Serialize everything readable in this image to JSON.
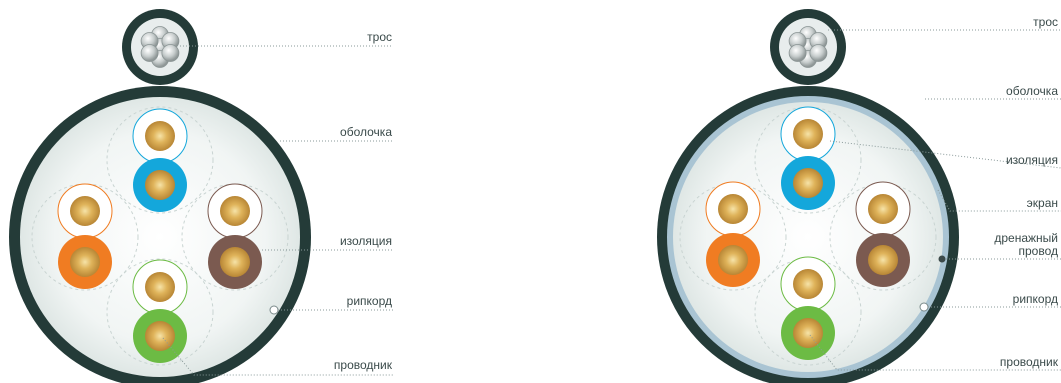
{
  "colors": {
    "jacket": "#243b38",
    "screen": "#a9c4d3",
    "blue": "#14a7db",
    "orange": "#f07c22",
    "brown": "#7b5a50",
    "green": "#6cbb44",
    "copper": "#d9a84b",
    "label": "#3a4a4a"
  },
  "diagrams": [
    {
      "id": "utp",
      "labels": {
        "messenger": "трос",
        "sheath": "оболочка",
        "insulation": "изоляция",
        "ripcord": "рипкорд",
        "conductor": "проводник"
      }
    },
    {
      "id": "ftp",
      "labels": {
        "messenger": "трос",
        "sheath": "оболочка",
        "insulation": "изоляция",
        "screen": "экран",
        "drain_line1": "дренажный",
        "drain_line2": "провод",
        "ripcord": "рипкорд",
        "conductor": "проводник"
      }
    }
  ]
}
